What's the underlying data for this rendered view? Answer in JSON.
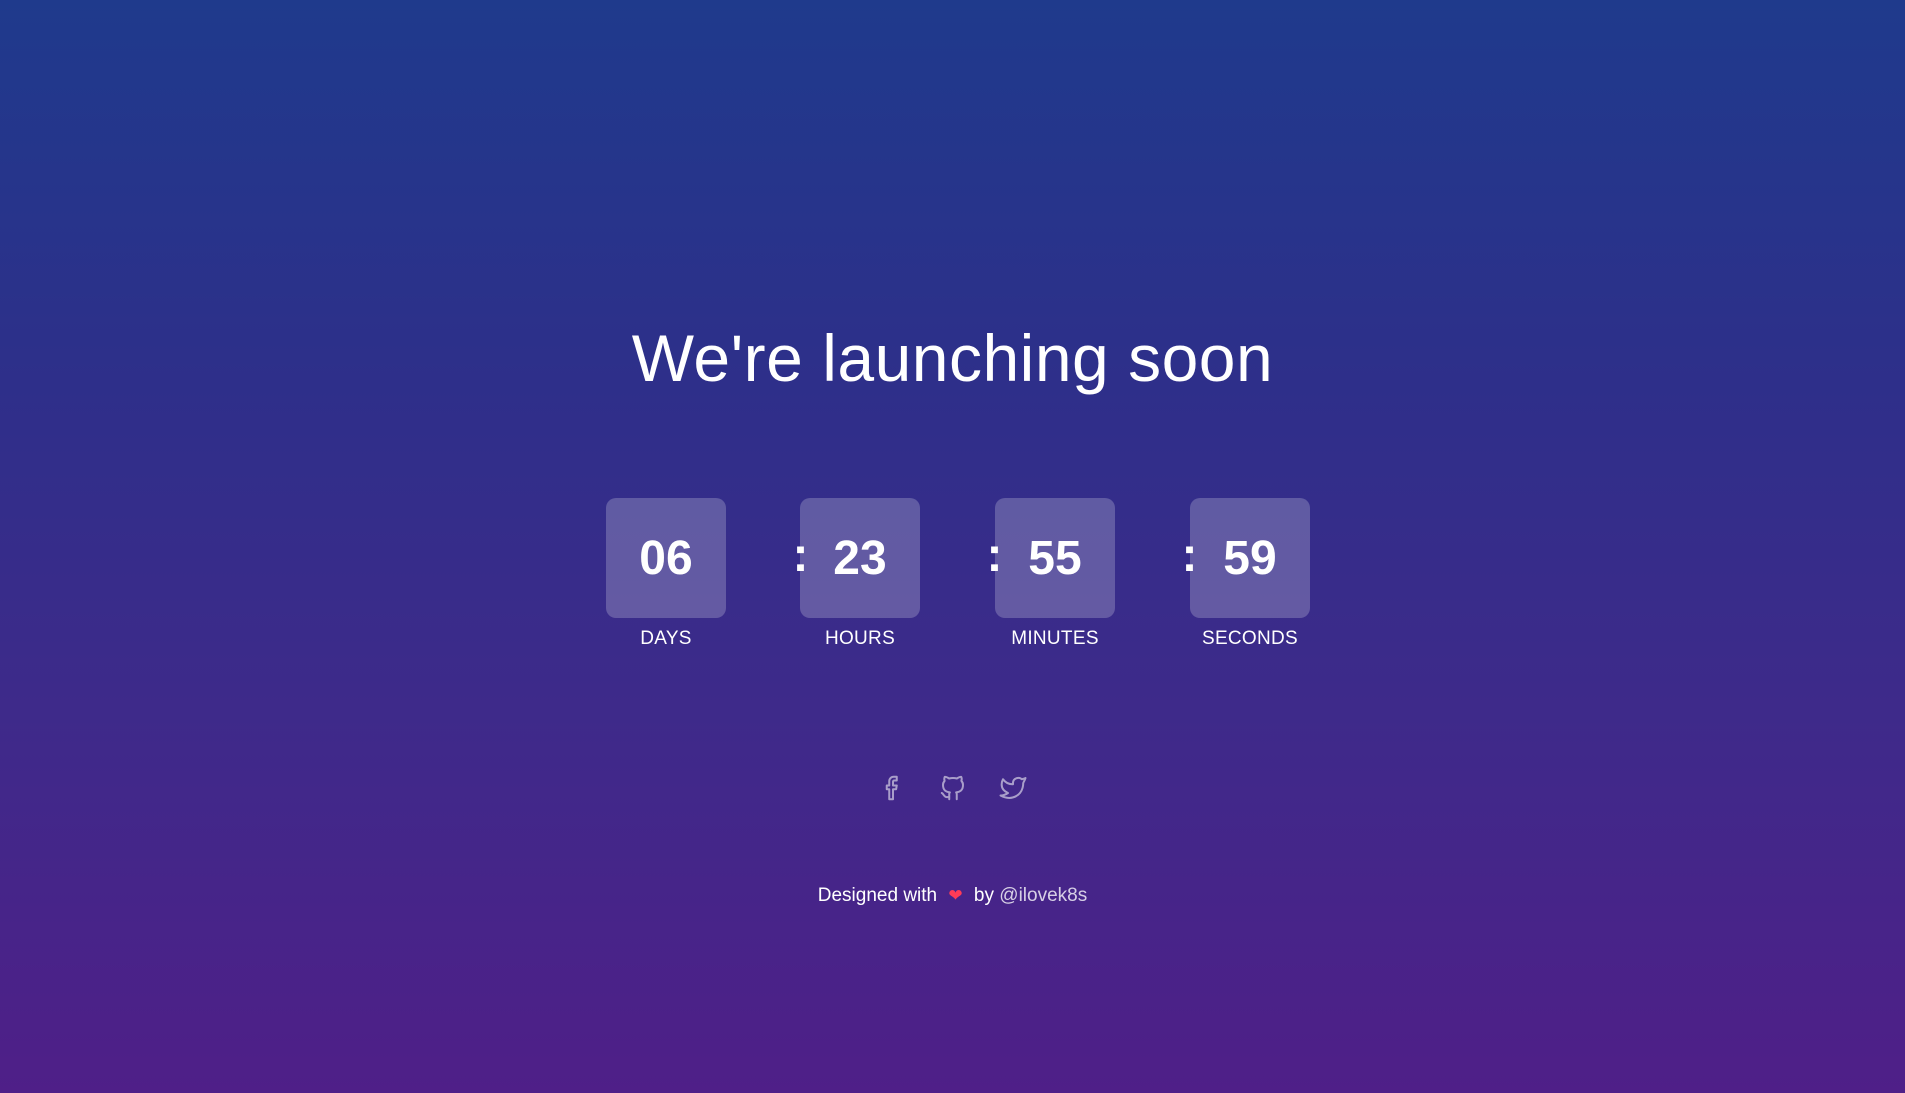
{
  "headline": "We're launching soon",
  "countdown": {
    "days": {
      "value": "06",
      "label": "DAYS"
    },
    "hours": {
      "value": "23",
      "label": "HOURS"
    },
    "minutes": {
      "value": "55",
      "label": "MINUTES"
    },
    "seconds": {
      "value": "59",
      "label": "SECONDS"
    },
    "separator": ":"
  },
  "social": {
    "icons": [
      "facebook-icon",
      "github-icon",
      "twitter-icon"
    ]
  },
  "footer": {
    "prefix": "Designed with",
    "heart_icon": "heart-icon",
    "by": "by",
    "author": "@ilovek8s"
  },
  "colors": {
    "gradient_top": "#1f3a8c",
    "gradient_bottom": "#4f1f88",
    "heart": "#ff3b57"
  }
}
